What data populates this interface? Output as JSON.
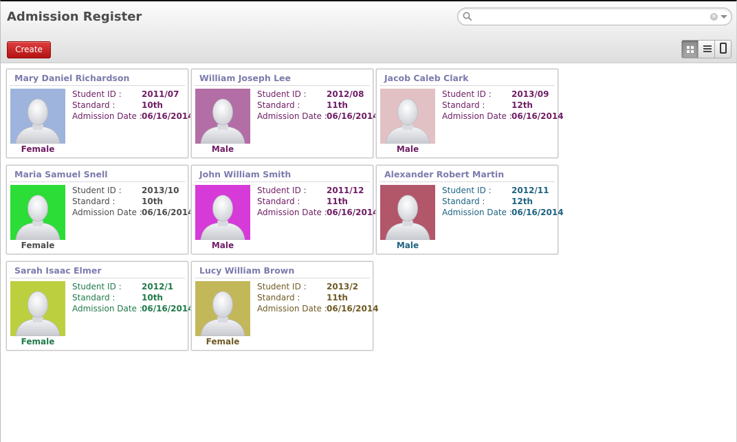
{
  "header": {
    "title": "Admission Register",
    "search": {
      "value": "",
      "placeholder": ""
    },
    "create_label": "Create",
    "views": [
      "kanban-view",
      "list-view",
      "form-view"
    ],
    "active_view": "kanban-view"
  },
  "labels": {
    "student_id": "Student ID :",
    "standard": "Standard :",
    "admission_date": "Admission Date :"
  },
  "cards": [
    {
      "name": "Mary Daniel Richardson",
      "student_id": "2011/07",
      "standard": "10th",
      "admission_date": "06/16/2014",
      "gender": "Female",
      "photo_bg": "#9fb4dc",
      "text_color": "#6e1d64"
    },
    {
      "name": "William Joseph Lee",
      "student_id": "2012/08",
      "standard": "11th",
      "admission_date": "06/16/2014",
      "gender": "Male",
      "photo_bg": "#b36ea6",
      "text_color": "#6e1d64"
    },
    {
      "name": "Jacob Caleb Clark",
      "student_id": "2013/09",
      "standard": "12th",
      "admission_date": "06/16/2014",
      "gender": "Male",
      "photo_bg": "#e2c1c5",
      "text_color": "#6e1d64"
    },
    {
      "name": "Maria Samuel Snell",
      "student_id": "2013/10",
      "standard": "10th",
      "admission_date": "06/16/2014",
      "gender": "Female",
      "photo_bg": "#2bdd36",
      "text_color": "#4c4c4c"
    },
    {
      "name": "John William Smith",
      "student_id": "2011/12",
      "standard": "11th",
      "admission_date": "06/16/2014",
      "gender": "Male",
      "photo_bg": "#d63ad9",
      "text_color": "#6e1d64"
    },
    {
      "name": "Alexander Robert Martin",
      "student_id": "2012/11",
      "standard": "12th",
      "admission_date": "06/16/2014",
      "gender": "Male",
      "photo_bg": "#b2566a",
      "text_color": "#1e6282"
    },
    {
      "name": "Sarah Isaac Elmer",
      "student_id": "2012/1",
      "standard": "10th",
      "admission_date": "06/16/2014",
      "gender": "Female",
      "photo_bg": "#bccf3f",
      "text_color": "#1f7a4a"
    },
    {
      "name": "Lucy William Brown",
      "student_id": "2013/2",
      "standard": "11th",
      "admission_date": "06/16/2014",
      "gender": "Female",
      "photo_bg": "#c2b85a",
      "text_color": "#6e5a24"
    }
  ]
}
